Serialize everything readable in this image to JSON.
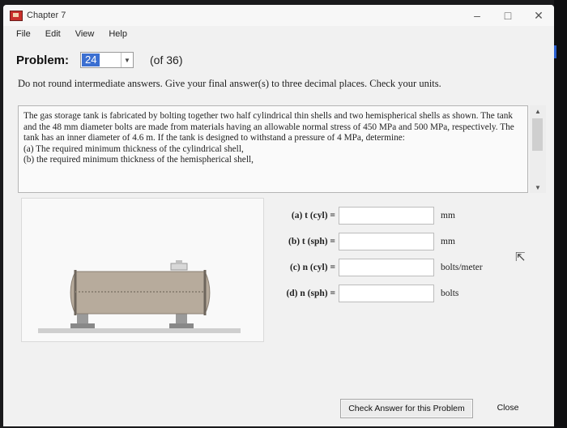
{
  "window": {
    "title": "Chapter 7",
    "controls": [
      "–",
      "□",
      "✕"
    ]
  },
  "menu": [
    "File",
    "Edit",
    "View",
    "Help"
  ],
  "problem": {
    "label": "Problem:",
    "selected": "24",
    "of_total": "(of 36)"
  },
  "instructions": "Do not round intermediate answers. Give your final answer(s) to three decimal places. Check your units.",
  "question": {
    "text": "The gas storage tank is fabricated by bolting together two half cylindrical thin shells and two hemispherical shells as shown. The tank and the 48 mm diameter bolts are made from materials having an allowable normal stress of 450 MPa and 500 MPa, respectively. The tank has an inner diameter of 4.6 m. If the tank is designed to withstand a pressure of 4 MPa, determine:",
    "part_a": "(a) The required minimum thickness of the cylindrical shell,",
    "part_b": "(b) the required minimum thickness of the hemispherical shell,"
  },
  "answers": [
    {
      "label": "(a) t (cyl) =",
      "value": "",
      "unit": "mm"
    },
    {
      "label": "(b) t (sph) =",
      "value": "",
      "unit": "mm"
    },
    {
      "label": "(c) n (cyl) =",
      "value": "",
      "unit": "bolts/meter"
    },
    {
      "label": "(d) n (sph) =",
      "value": "",
      "unit": "bolts"
    }
  ],
  "buttons": {
    "check": "Check Answer for this Problem",
    "close": "Close"
  },
  "icons": {
    "app": "app-icon",
    "cursor": "cursor-icon"
  }
}
